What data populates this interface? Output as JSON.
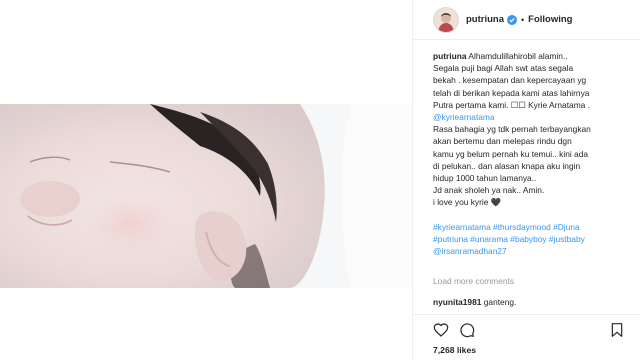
{
  "post": {
    "username": "putriuna",
    "follow_status": "Following",
    "separator": "•"
  },
  "caption": {
    "username": "putriuna",
    "line1": "Alhamdulillahirobil alamin..",
    "line2": "Segala puji bagi Allah swt atas segala",
    "line3": "bekah . kesempatan dan kepercayaan yg",
    "line4": "telah di berikan kepada kami atas lahirnya",
    "line5": "Putra pertama kami. ☐☐ Kyrie Arnatama .",
    "mention1": "@kyriearnatama",
    "line6": "Rasa bahagia yg tdk pernah terbayangkan",
    "line7": "akan bertemu dan melepas rindu dgn",
    "line8": "kamu yg belum pernah ku temui.. kini ada",
    "line9": "di pelukan.. dan alasan knapa aku ingin",
    "line10": "hidup 1000 tahun lamanya..",
    "line11": "Jd anak sholeh ya nak.. Amin.",
    "line12": "i love you kyrie",
    "line12_emoji": "🖤",
    "hashtags1": "#kyriearnatama #thursdaymood #Djuna",
    "hashtags2": "#putriuna #unarama #babyboy #justbaby",
    "mention2": "@irsanramadhan27"
  },
  "view_more": "Load more comments",
  "comment": {
    "username": "nyunita1981",
    "text": "ganteng."
  },
  "likes": "7,268 likes",
  "icons": [
    "heart-icon",
    "comment-icon",
    "bookmark-icon",
    "verified-icon"
  ],
  "colors": {
    "link": "#3897f0",
    "verified": "#3897f0",
    "border": "#efefef"
  }
}
